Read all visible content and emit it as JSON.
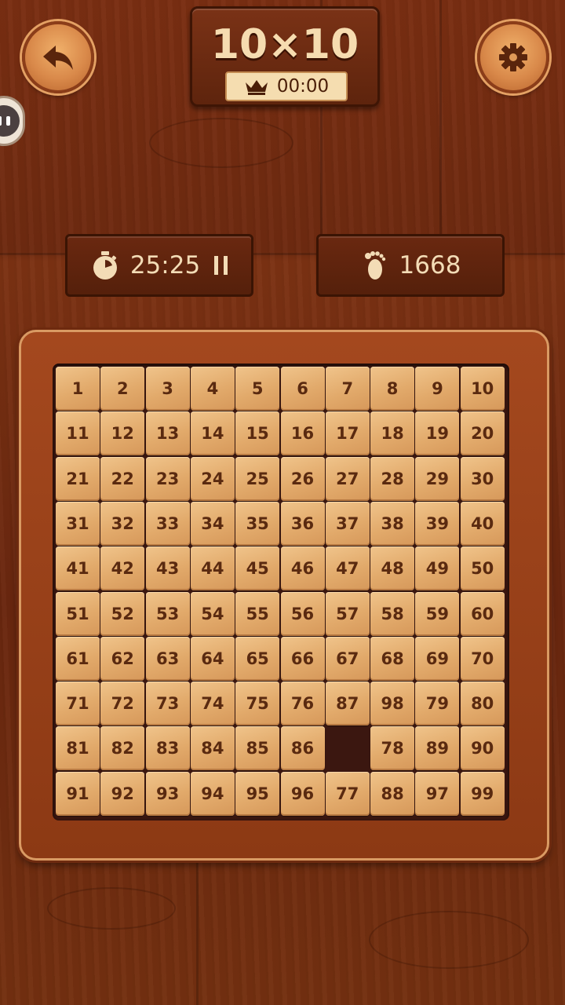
{
  "header": {
    "title": "10×10",
    "best_time": "00:00"
  },
  "stats": {
    "timer": "25:25",
    "moves": "1668"
  },
  "board": {
    "rows": 10,
    "cols": 10,
    "tiles": [
      [
        1,
        2,
        3,
        4,
        5,
        6,
        7,
        8,
        9,
        10
      ],
      [
        11,
        12,
        13,
        14,
        15,
        16,
        17,
        18,
        19,
        20
      ],
      [
        21,
        22,
        23,
        24,
        25,
        26,
        27,
        28,
        29,
        30
      ],
      [
        31,
        32,
        33,
        34,
        35,
        36,
        37,
        38,
        39,
        40
      ],
      [
        41,
        42,
        43,
        44,
        45,
        46,
        47,
        48,
        49,
        50
      ],
      [
        51,
        52,
        53,
        54,
        55,
        56,
        57,
        58,
        59,
        60
      ],
      [
        61,
        62,
        63,
        64,
        65,
        66,
        67,
        68,
        69,
        70
      ],
      [
        71,
        72,
        73,
        74,
        75,
        76,
        87,
        98,
        79,
        80
      ],
      [
        81,
        82,
        83,
        84,
        85,
        86,
        null,
        78,
        89,
        90
      ],
      [
        91,
        92,
        93,
        94,
        95,
        96,
        77,
        88,
        97,
        99
      ]
    ]
  },
  "icons": {
    "back": "back-arrow-icon",
    "settings": "gear-icon",
    "best": "crown-icon",
    "timer": "stopwatch-icon",
    "pause": "pause-icon",
    "moves": "footprint-icon"
  }
}
